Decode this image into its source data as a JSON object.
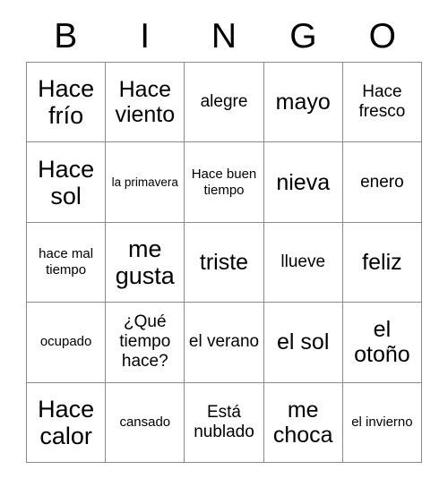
{
  "card": {
    "headers": [
      "B",
      "I",
      "N",
      "G",
      "O"
    ],
    "rows": [
      [
        {
          "text": "Hace frío",
          "size": "xl"
        },
        {
          "text": "Hace viento",
          "size": "lg"
        },
        {
          "text": "alegre",
          "size": "md"
        },
        {
          "text": "mayo",
          "size": "lg"
        },
        {
          "text": "Hace fresco",
          "size": "md"
        }
      ],
      [
        {
          "text": "Hace sol",
          "size": "xl"
        },
        {
          "text": "la primavera",
          "size": "xs"
        },
        {
          "text": "Hace buen tiempo",
          "size": "sm"
        },
        {
          "text": "nieva",
          "size": "lg"
        },
        {
          "text": "enero",
          "size": "md"
        }
      ],
      [
        {
          "text": "hace mal tiempo",
          "size": "sm"
        },
        {
          "text": "me gusta",
          "size": "xl"
        },
        {
          "text": "triste",
          "size": "lg"
        },
        {
          "text": "llueve",
          "size": "md"
        },
        {
          "text": "feliz",
          "size": "lg"
        }
      ],
      [
        {
          "text": "ocupado",
          "size": "sm"
        },
        {
          "text": "¿Qué tiempo hace?",
          "size": "md"
        },
        {
          "text": "el verano",
          "size": "md"
        },
        {
          "text": "el sol",
          "size": "lg"
        },
        {
          "text": "el otoño",
          "size": "lg"
        }
      ],
      [
        {
          "text": "Hace calor",
          "size": "xl"
        },
        {
          "text": "cansado",
          "size": "sm"
        },
        {
          "text": "Está nublado",
          "size": "md"
        },
        {
          "text": "me choca",
          "size": "lg"
        },
        {
          "text": "el invierno",
          "size": "sm"
        }
      ]
    ]
  },
  "colors": {
    "text": "#000000",
    "border": "#8a8a8a",
    "background": "#ffffff"
  }
}
